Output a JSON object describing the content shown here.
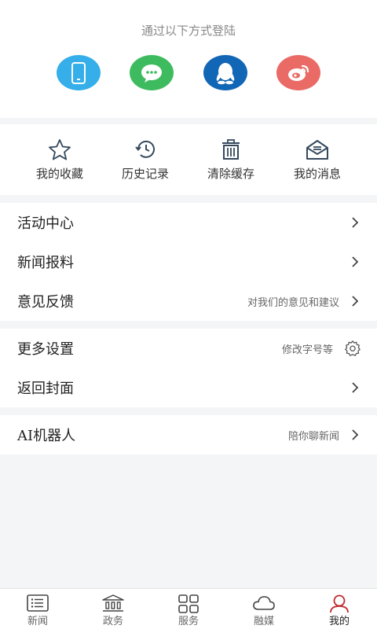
{
  "login": {
    "title": "通过以下方式登陆",
    "methods": [
      {
        "icon": "phone-icon",
        "color": "#35aee9"
      },
      {
        "icon": "wechat-icon",
        "color": "#3fbb5f"
      },
      {
        "icon": "qq-icon",
        "color": "#1166b5"
      },
      {
        "icon": "weibo-icon",
        "color": "#ea6a66"
      }
    ]
  },
  "quick": {
    "items": [
      {
        "label": "我的收藏",
        "icon": "star-icon"
      },
      {
        "label": "历史记录",
        "icon": "history-icon"
      },
      {
        "label": "清除缓存",
        "icon": "trash-icon"
      },
      {
        "label": "我的消息",
        "icon": "mail-icon"
      }
    ]
  },
  "menu": {
    "group1": [
      {
        "label": "活动中心",
        "hint": ""
      },
      {
        "label": "新闻报料",
        "hint": ""
      },
      {
        "label": "意见反馈",
        "hint": "对我们的意见和建议"
      }
    ],
    "group2": [
      {
        "label": "更多设置",
        "hint": "修改字号等"
      },
      {
        "label": "返回封面",
        "hint": ""
      }
    ],
    "group3": [
      {
        "label": "AI机器人",
        "hint": "陪你聊新闻"
      }
    ]
  },
  "tabbar": {
    "tabs": [
      {
        "label": "新闻",
        "icon": "news-list-icon"
      },
      {
        "label": "政务",
        "icon": "government-building-icon"
      },
      {
        "label": "服务",
        "icon": "grid-icon"
      },
      {
        "label": "融媒",
        "icon": "cloud-icon"
      },
      {
        "label": "我的",
        "icon": "user-icon"
      }
    ],
    "active_index": 4,
    "active_color": "#c0282d"
  }
}
